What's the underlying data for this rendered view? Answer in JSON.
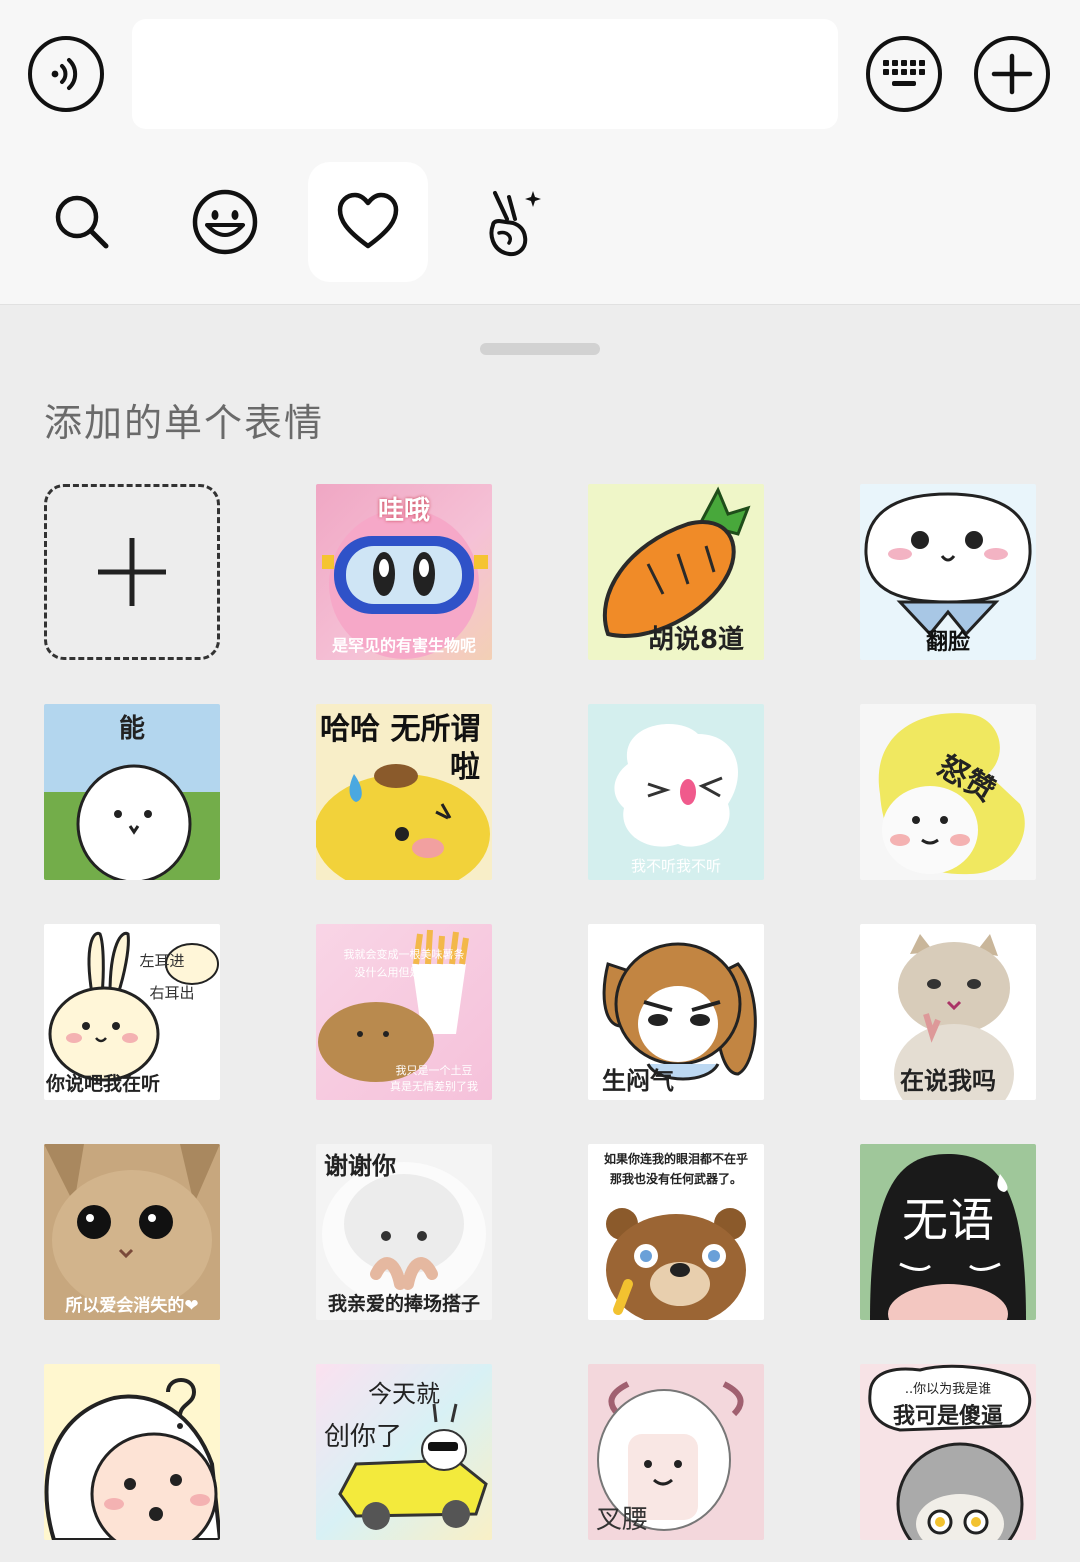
{
  "input_bar": {
    "voice_icon": "voice-icon",
    "keyboard_icon": "keyboard-icon",
    "plus_icon": "plus-icon",
    "text_value": ""
  },
  "tabs": [
    {
      "name": "search",
      "icon": "search-icon",
      "active": false
    },
    {
      "name": "emoji",
      "icon": "smiley-icon",
      "active": false
    },
    {
      "name": "favorites",
      "icon": "heart-icon",
      "active": true
    },
    {
      "name": "gesture",
      "icon": "victory-hand-icon",
      "active": false
    }
  ],
  "panel": {
    "section_title": "添加的单个表情"
  },
  "stickers": [
    {
      "top": "哇哦",
      "bottom": "是罕见的有害生物呢",
      "bg": "#f39ac5"
    },
    {
      "top": "",
      "bottom": "胡说8道",
      "bg": "#f2f7c8"
    },
    {
      "top": "",
      "bottom": "翻脸",
      "bg": "#e8f4fb"
    },
    {
      "top": "能",
      "bottom": "",
      "bg": "#a9cfe9"
    },
    {
      "top": "哈哈 无所谓",
      "top2": "啦",
      "bottom": "",
      "bg": "#f7ecc0"
    },
    {
      "top": "",
      "bottom": "我不听我不听",
      "bg": "#d3efef"
    },
    {
      "top": "怒赞",
      "bottom": "",
      "bg": "#f6f6f6"
    },
    {
      "top": "左耳进",
      "top2": "右耳出",
      "bottom": "你说吧我在听",
      "bg": "#ffffff"
    },
    {
      "top": "我就会变成一根美味薯条",
      "top2": "没什么用但是脆脆的",
      "bottom": "我只是一个土豆",
      "bottom2": "真是无情差别了我",
      "bg": "#f8d6e6"
    },
    {
      "top": "",
      "bottom": "生闷气",
      "bg": "#ffffff"
    },
    {
      "top": "",
      "bottom": "在说我吗",
      "bg": "#ffffff"
    },
    {
      "top": "",
      "bottom": "所以爱会消失的❤",
      "bg": "#b89a78"
    },
    {
      "top": "谢谢你",
      "bottom": "我亲爱的捧场搭子",
      "bg": "#f4f4f4"
    },
    {
      "top": "如果你连我的眼泪都不在乎",
      "top2": "那我也没有任何武器了。",
      "bottom": "",
      "bg": "#ffffff"
    },
    {
      "top": "",
      "bottom": "无语",
      "bg": "#9fc79a"
    },
    {
      "top": "",
      "bottom": "",
      "bg": "#fff7cf"
    },
    {
      "top": "今天就",
      "top2": "创你了",
      "bottom": "",
      "bg": "#e4f2f7"
    },
    {
      "top": "",
      "bottom": "叉腰",
      "bg": "#f3d7dc"
    },
    {
      "top": "..你以为我是谁",
      "top2": "我可是傻逼",
      "bottom": "",
      "bg": "#f7e3e6"
    }
  ]
}
